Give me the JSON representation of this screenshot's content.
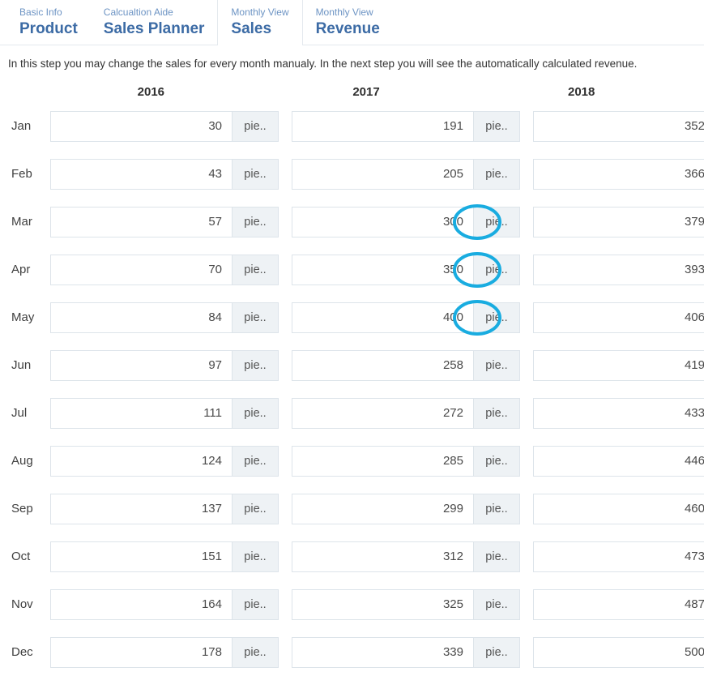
{
  "tabs": [
    {
      "sub": "Basic Info",
      "main": "Product",
      "active": false
    },
    {
      "sub": "Calcualtion Aide",
      "main": "Sales Planner",
      "active": false
    },
    {
      "sub": "Monthly View",
      "main": "Sales",
      "active": true
    },
    {
      "sub": "Monthly View",
      "main": "Revenue",
      "active": false
    }
  ],
  "intro": "In this step you may change the sales for every month manualy. In the next step you will see the automatically calculated revenue.",
  "years": [
    "2016",
    "2017",
    "2018"
  ],
  "months": [
    "Jan",
    "Feb",
    "Mar",
    "Apr",
    "May",
    "Jun",
    "Jul",
    "Aug",
    "Sep",
    "Oct",
    "Nov",
    "Dec"
  ],
  "unit_label": "pie..",
  "columns": [
    {
      "year": "2016",
      "values": [
        "30",
        "43",
        "57",
        "70",
        "84",
        "97",
        "111",
        "124",
        "137",
        "151",
        "164",
        "178"
      ]
    },
    {
      "year": "2017",
      "values": [
        "191",
        "205",
        "300",
        "350",
        "400",
        "258",
        "272",
        "285",
        "299",
        "312",
        "325",
        "339"
      ]
    },
    {
      "year": "2018",
      "values": [
        "352",
        "366",
        "379",
        "393",
        "406",
        "419",
        "433",
        "446",
        "460",
        "473",
        "487",
        "500"
      ]
    }
  ],
  "highlights": [
    {
      "column": 1,
      "row": 2
    },
    {
      "column": 1,
      "row": 3
    },
    {
      "column": 1,
      "row": 4
    }
  ],
  "colors": {
    "highlight": "#19ace0",
    "tab_main": "#3c6ba5",
    "tab_sub": "#6d94c4",
    "addon_bg": "#eef2f5",
    "border": "#dde4ea"
  }
}
